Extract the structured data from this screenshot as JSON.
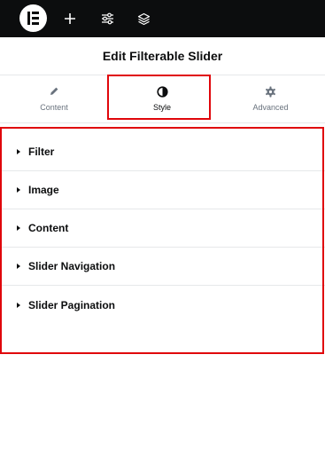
{
  "topbar": {
    "icons": [
      "elementor-logo-icon",
      "plus-icon",
      "sliders-icon",
      "layers-icon"
    ],
    "background": "#0c0d0e"
  },
  "panel": {
    "title": "Edit Filterable Slider"
  },
  "tabs": [
    {
      "label": "Content",
      "icon": "pencil-icon",
      "active": false
    },
    {
      "label": "Style",
      "icon": "half-circle-icon",
      "active": true
    },
    {
      "label": "Advanced",
      "icon": "gear-icon",
      "active": false
    }
  ],
  "sections": [
    {
      "label": "Filter"
    },
    {
      "label": "Image"
    },
    {
      "label": "Content"
    },
    {
      "label": "Slider Navigation"
    },
    {
      "label": "Slider Pagination"
    }
  ],
  "colors": {
    "highlight": "#e0060b",
    "text": "#0c0d0e",
    "muted": "#69727d"
  }
}
